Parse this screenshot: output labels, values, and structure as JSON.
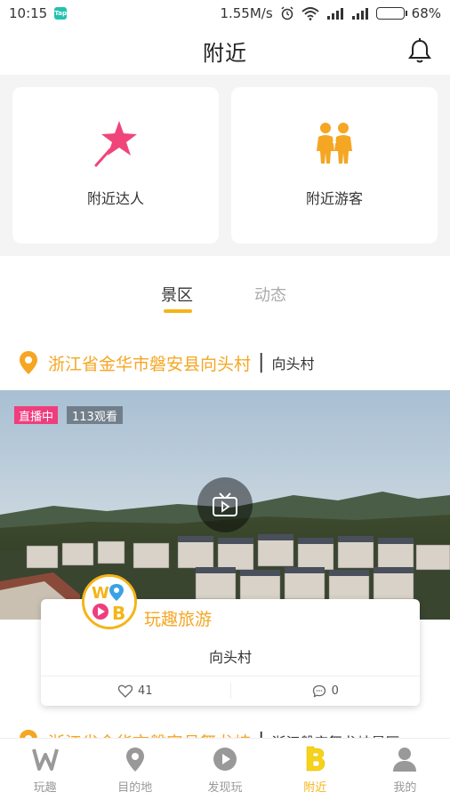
{
  "status_bar": {
    "time": "10:15",
    "app_badge": "Tap",
    "speed": "1.55M/s",
    "battery": "68%"
  },
  "header": {
    "title": "附近"
  },
  "cards": [
    {
      "label": "附近达人",
      "icon": "star-wand-icon"
    },
    {
      "label": "附近游客",
      "icon": "people-icon"
    }
  ],
  "tabs": [
    {
      "label": "景区",
      "active": true
    },
    {
      "label": "动态",
      "active": false
    }
  ],
  "location1": {
    "address": "浙江省金华市磐安县向头村",
    "name": "向头村"
  },
  "video": {
    "live_label": "直播中",
    "views": "113观看"
  },
  "info_card": {
    "name": "玩趣旅游",
    "description": "向头村",
    "likes": "41",
    "comments": "0"
  },
  "location2": {
    "address": "浙江省金华市磐安县舞龙峡",
    "name": "浙江磐安舞龙峡景区"
  },
  "bottom_nav": [
    {
      "label": "玩趣",
      "icon": "w-logo-icon",
      "active": false
    },
    {
      "label": "目的地",
      "icon": "location-pin-icon",
      "active": false
    },
    {
      "label": "发现玩",
      "icon": "play-circle-icon",
      "active": false
    },
    {
      "label": "附近",
      "icon": "b-logo-icon",
      "active": true
    },
    {
      "label": "我的",
      "icon": "user-icon",
      "active": false
    }
  ],
  "colors": {
    "accent": "#f5b417",
    "location_text": "#f5a623",
    "live_badge": "#ef3d7d",
    "pink_star": "#f0457a"
  }
}
